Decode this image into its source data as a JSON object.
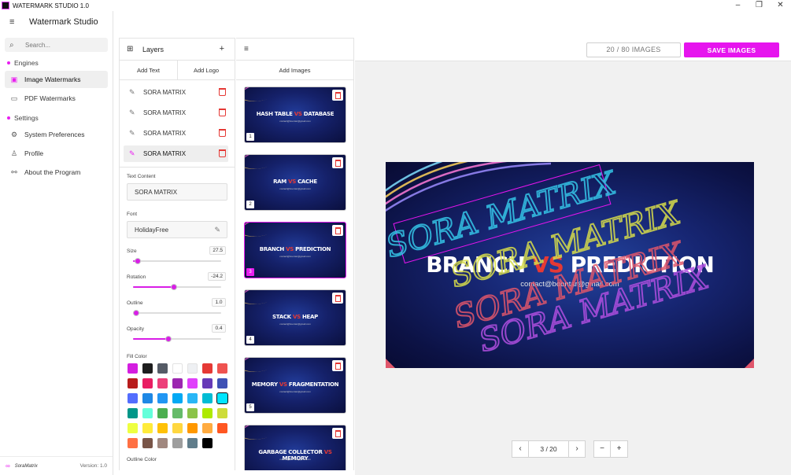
{
  "window": {
    "title": "WATERMARK STUDIO 1.0",
    "controls": [
      "–",
      "❐",
      "✕"
    ]
  },
  "sidebar": {
    "app_name": "Watermark Studio",
    "search_placeholder": "Search...",
    "sections": [
      {
        "label": "Engines",
        "items": [
          {
            "label": "Image Watermarks",
            "icon": "image-icon",
            "active": true
          },
          {
            "label": "PDF Watermarks",
            "icon": "folder-icon",
            "active": false
          }
        ]
      },
      {
        "label": "Settings",
        "items": [
          {
            "label": "System Preferences",
            "icon": "gear-icon",
            "active": false
          },
          {
            "label": "Profile",
            "icon": "user-icon",
            "active": false
          },
          {
            "label": "About the Program",
            "icon": "link-icon",
            "active": false
          }
        ]
      }
    ],
    "footer": {
      "brand": "SoraMatrix",
      "version": "Version: 1.0"
    }
  },
  "layers": {
    "title": "Layers",
    "tabs": [
      "Add Text",
      "Add Logo"
    ],
    "items": [
      {
        "label": "SORA MATRIX",
        "selected": false
      },
      {
        "label": "SORA MATRIX",
        "selected": false
      },
      {
        "label": "SORA MATRIX",
        "selected": false
      },
      {
        "label": "SORA MATRIX",
        "selected": true
      }
    ],
    "text_content_label": "Text Content",
    "text_content_value": "SORA MATRIX",
    "font_label": "Font",
    "font_value": "HolidayFree",
    "sliders": [
      {
        "label": "Size",
        "value": "27.5",
        "fraction": 0.05
      },
      {
        "label": "Rotation",
        "value": "-24.2",
        "fraction": 0.46
      },
      {
        "label": "Outline",
        "value": "1.0",
        "fraction": 0.04
      },
      {
        "label": "Opacity",
        "value": "0.4",
        "fraction": 0.4
      }
    ],
    "fill_color_label": "Fill Color",
    "fill_colors": [
      "#d41ee0",
      "#1e1e1e",
      "#555b66",
      "#ffffff",
      "#eef0f3",
      "#e53935",
      "#ef5350",
      "#b71c1c",
      "#e91e63",
      "#ec407a",
      "#9c27b0",
      "#e040fb",
      "#673ab7",
      "#3f51b5",
      "#536dfe",
      "#1e88e5",
      "#2196f3",
      "#03a9f4",
      "#29b6f6",
      "#00bcd4",
      "#00e5ff",
      "#009688",
      "#64ffda",
      "#4caf50",
      "#66bb6a",
      "#8bc34a",
      "#aeea00",
      "#cddc39",
      "#eeff41",
      "#ffeb3b",
      "#ffc107",
      "#ffd740",
      "#ff9800",
      "#ffab40",
      "#ff5722",
      "#ff7043",
      "#795548",
      "#a1887f",
      "#9e9e9e",
      "#607d8b",
      "#000000"
    ],
    "selected_fill_index": 20,
    "outline_color_label": "Outline Color"
  },
  "images": {
    "add_label": "Add Images",
    "thumbnails": [
      {
        "left": "HASH TABLE",
        "vs": "VS",
        "right": "DATABASE",
        "num": "1",
        "selected": false
      },
      {
        "left": "RAM",
        "vs": "VS",
        "right": "CACHE",
        "num": "2",
        "selected": false
      },
      {
        "left": "BRANCH",
        "vs": "VS",
        "right": "PREDICTION",
        "num": "3",
        "selected": true
      },
      {
        "left": "STACK",
        "vs": "VS",
        "right": "HEAP",
        "num": "4",
        "selected": false
      },
      {
        "left": "MEMORY",
        "vs": "VS",
        "right": "FRAGMENTATION",
        "num": "5",
        "selected": false
      },
      {
        "left": "GARBAGE COLLECTOR",
        "vs": "VS",
        "right": "MEMORY",
        "num": "6",
        "selected": false
      }
    ]
  },
  "main": {
    "counter": "20 / 80 IMAGES",
    "save_label": "SAVE IMAGES",
    "preview": {
      "title_left": "BRANCH ",
      "title_vs": "VS",
      "title_right": " PREDICTION",
      "subtitle": "contact@boontar@gmail.com",
      "watermark_text": "SORA MATRIX",
      "watermark_colors": [
        "#35c6e8",
        "#d8dd4a",
        "#e0566b",
        "#b04fe0"
      ]
    },
    "pager": {
      "prev": "‹",
      "label": "3 / 20",
      "next": "›"
    },
    "zoom": {
      "out": "−",
      "in": "+"
    }
  },
  "theme": {
    "accent": "#e614ee"
  }
}
